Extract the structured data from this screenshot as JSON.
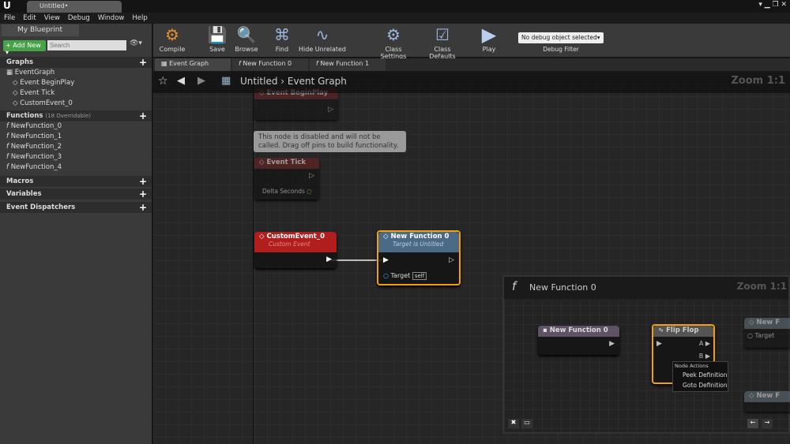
{
  "window": {
    "tab_title": "Untitled•",
    "menu": [
      "File",
      "Edit",
      "View",
      "Debug",
      "Window",
      "Help"
    ]
  },
  "sidebar": {
    "tab": "My Blueprint",
    "add_new": "Add New",
    "search_placeholder": "Search",
    "graphs": {
      "label": "Graphs",
      "items": [
        "EventGraph",
        "Event BeginPlay",
        "Event Tick",
        "CustomEvent_0"
      ]
    },
    "functions": {
      "label": "Functions",
      "count": "(18 Overridable)",
      "items": [
        "NewFunction_0",
        "NewFunction_1",
        "NewFunction_2",
        "NewFunction_3",
        "NewFunction_4"
      ]
    },
    "macros": "Macros",
    "variables": "Variables",
    "dispatchers": "Event Dispatchers"
  },
  "toolbar": {
    "compile": "Compile",
    "save": "Save",
    "browse": "Browse",
    "find": "Find",
    "hide_unrelated": "Hide Unrelated",
    "class_settings": "Class Settings",
    "class_defaults": "Class Defaults",
    "play": "Play",
    "debug_select": "No debug object selected",
    "debug_filter": "Debug Filter"
  },
  "tabs": [
    "Event Graph",
    "New Function 0",
    "New Function 1"
  ],
  "graph": {
    "breadcrumb_root": "Untitled",
    "breadcrumb_leaf": "Event Graph",
    "zoom": "Zoom 1:1",
    "bubble": "This node is disabled and will not be called. Drag off pins to build functionality.",
    "begin_play": "Event BeginPlay",
    "event_tick": "Event Tick",
    "delta_seconds": "Delta Seconds",
    "custom_event": "CustomEvent_0",
    "custom_event_sub": "Custom Event",
    "call_node": "New Function 0",
    "call_node_sub": "Target is Untitled",
    "target": "Target",
    "self": "self"
  },
  "peek": {
    "title": "New Function 0",
    "zoom": "Zoom 1:1",
    "entry": "New Function 0",
    "flipflop": "Flip Flop",
    "pin_a": "A",
    "pin_b": "B",
    "right_node": "New F",
    "right_target": "Target",
    "menu": {
      "header": "Node Actions",
      "items": [
        "Peek Definition",
        "Goto Definition"
      ]
    }
  }
}
